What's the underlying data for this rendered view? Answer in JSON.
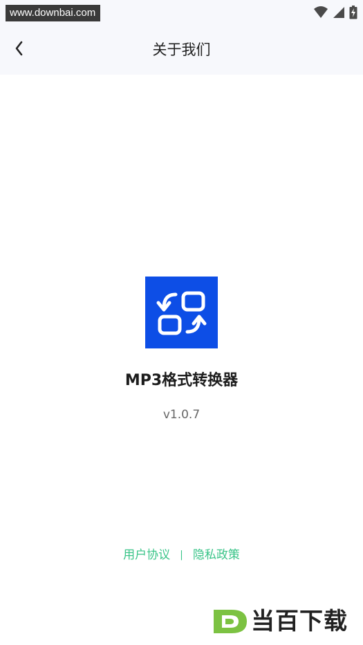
{
  "status_bar": {
    "watermark_url": "www.downbai.com",
    "icons": [
      "wifi-icon",
      "cellular-signal-icon",
      "battery-charging-icon"
    ]
  },
  "header": {
    "back_icon": "chevron-left-icon",
    "title": "关于我们"
  },
  "app": {
    "icon": "format-convert-icon",
    "icon_color": "#0d4ee6",
    "name": "MP3格式转换器",
    "version": "v1.0.7"
  },
  "footer": {
    "user_agreement": "用户协议",
    "separator": "|",
    "privacy_policy": "隐私政策",
    "link_color": "#39c488"
  },
  "brand_watermark": {
    "icon": "d-logo-icon",
    "text": "当百下载",
    "accent_color": "#7cc242"
  }
}
